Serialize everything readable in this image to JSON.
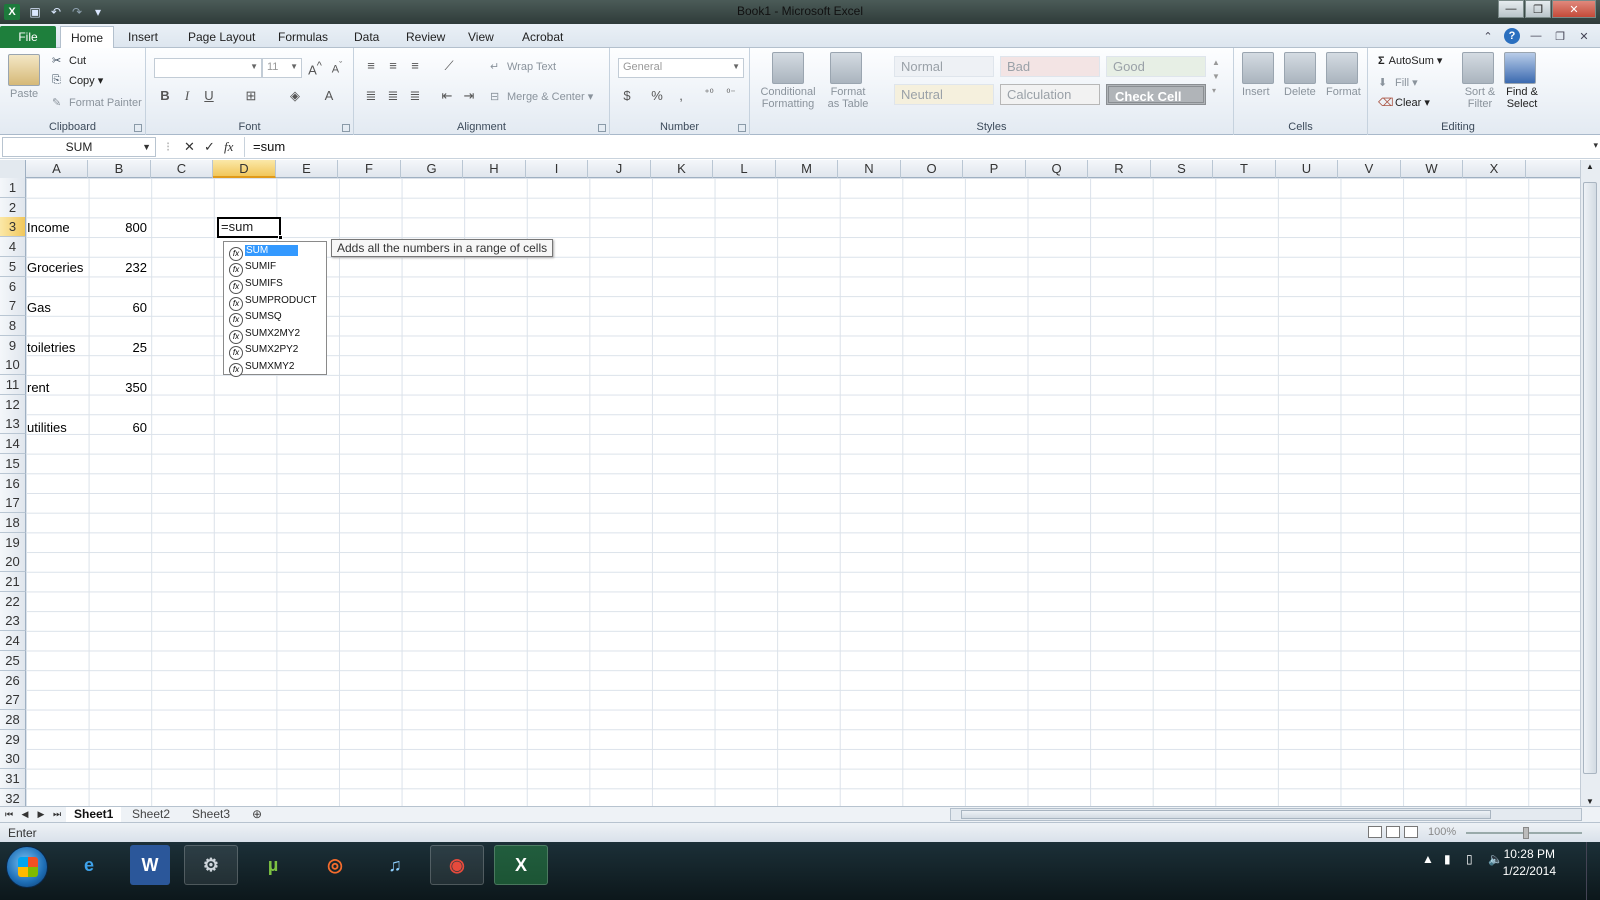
{
  "window": {
    "title": "Book1  -  Microsoft Excel",
    "app_icon": "excel-icon"
  },
  "ribbon_tabs": [
    {
      "label": "File"
    },
    {
      "label": "Home"
    },
    {
      "label": "Insert"
    },
    {
      "label": "Page Layout"
    },
    {
      "label": "Formulas"
    },
    {
      "label": "Data"
    },
    {
      "label": "Review"
    },
    {
      "label": "View"
    },
    {
      "label": "Acrobat"
    }
  ],
  "active_tab": "Home",
  "ribbon": {
    "clipboard": {
      "paste": "Paste",
      "cut": "Cut",
      "copy": "Copy",
      "format_painter": "Format Painter",
      "label": "Clipboard"
    },
    "font": {
      "font_name": "",
      "font_size": "11",
      "label": "Font",
      "bold": "B",
      "italic": "I",
      "underline": "U"
    },
    "alignment": {
      "wrap_text": "Wrap Text",
      "merge_center": "Merge & Center",
      "label": "Alignment"
    },
    "number": {
      "format": "General",
      "currency": "$",
      "percent": "%",
      "comma": ",",
      "label": "Number"
    },
    "styles": {
      "conditional_formatting_1": "Conditional",
      "conditional_formatting_2": "Formatting",
      "format_table_1": "Format",
      "format_table_2": "as Table",
      "cells": [
        "Normal",
        "Bad",
        "Good",
        "Neutral",
        "Calculation",
        "Check Cell"
      ],
      "label": "Styles"
    },
    "cells": {
      "insert": "Insert",
      "delete": "Delete",
      "format": "Format",
      "label": "Cells"
    },
    "editing": {
      "autosum": "AutoSum",
      "fill": "Fill",
      "clear": "Clear",
      "sort_1": "Sort &",
      "sort_2": "Filter",
      "find_1": "Find &",
      "find_2": "Select",
      "label": "Editing",
      "sigma": "Σ"
    }
  },
  "formula_bar": {
    "name_box": "SUM",
    "formula": "=sum",
    "cancel": "✕",
    "enter": "✓",
    "fx": "fx"
  },
  "columns": [
    "A",
    "B",
    "C",
    "D",
    "E",
    "F",
    "G",
    "H",
    "I",
    "J",
    "K",
    "L",
    "M",
    "N",
    "O",
    "P",
    "Q",
    "R",
    "S",
    "T",
    "U",
    "V",
    "W",
    "X"
  ],
  "rows": [
    "1",
    "2",
    "3",
    "4",
    "5",
    "6",
    "7",
    "8",
    "9",
    "10",
    "11",
    "12",
    "13",
    "14",
    "15",
    "16",
    "17",
    "18",
    "19",
    "20",
    "21",
    "22",
    "23",
    "24",
    "25",
    "26",
    "27",
    "28",
    "29",
    "30",
    "31",
    "32"
  ],
  "cells": [
    {
      "label": "Income",
      "value": "800"
    },
    {
      "label": "Groceries",
      "value": "232"
    },
    {
      "label": "Gas",
      "value": "60"
    },
    {
      "label": "toiletries",
      "value": "25"
    },
    {
      "label": "rent",
      "value": "350"
    },
    {
      "label": "utilities",
      "value": "60"
    }
  ],
  "active_cell": {
    "ref": "D3",
    "value": "=sum"
  },
  "autocomplete": {
    "items": [
      "SUM",
      "SUMIF",
      "SUMIFS",
      "SUMPRODUCT",
      "SUMSQ",
      "SUMX2MY2",
      "SUMX2PY2",
      "SUMXMY2"
    ],
    "selected": "SUM",
    "tooltip": "Adds all the numbers in a range of cells"
  },
  "sheets": [
    "Sheet1",
    "Sheet2",
    "Sheet3"
  ],
  "active_sheet": "Sheet1",
  "status": {
    "mode": "Enter",
    "zoom": "100%"
  },
  "taskbar": {
    "apps": [
      "internet-explorer-icon",
      "word-icon",
      "steam-icon",
      "utorrent-icon",
      "origin-icon",
      "itunes-icon",
      "chrome-icon",
      "excel-icon"
    ],
    "time": "10:28 PM",
    "date": "1/22/2014"
  }
}
